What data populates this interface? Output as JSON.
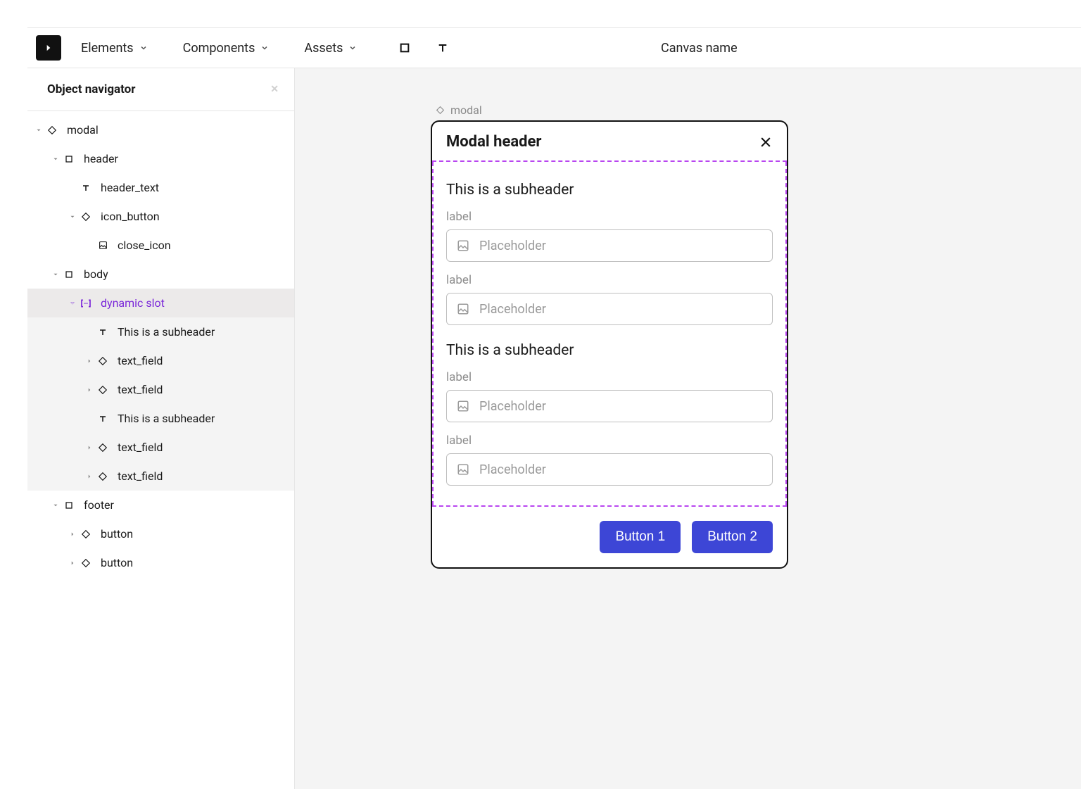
{
  "topbar": {
    "menus": [
      "Elements",
      "Components",
      "Assets"
    ],
    "canvas_name": "Canvas name"
  },
  "sidebar": {
    "title": "Object navigator",
    "tree": {
      "modal": "modal",
      "header": "header",
      "header_text": "header_text",
      "icon_button": "icon_button",
      "close_icon": "close_icon",
      "body": "body",
      "dynamic_slot": "dynamic slot",
      "sub1": "This is a subheader",
      "tf1": "text_field",
      "tf2": "text_field",
      "sub2": "This is a subheader",
      "tf3": "text_field",
      "tf4": "text_field",
      "footer": "footer",
      "btn1": "button",
      "btn2": "button"
    }
  },
  "canvas": {
    "tag": "modal",
    "modal": {
      "header": "Modal header",
      "subheader": "This is a subheader",
      "label": "label",
      "placeholder": "Placeholder",
      "button1": "Button 1",
      "button2": "Button 2"
    }
  }
}
